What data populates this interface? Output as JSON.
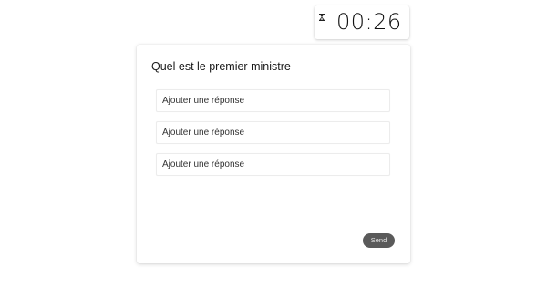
{
  "timer": {
    "icon": "hourglass-icon",
    "value": "00:26"
  },
  "question": {
    "title": "Quel est le premier ministre"
  },
  "answers": [
    {
      "placeholder": "Ajouter une réponse",
      "value": ""
    },
    {
      "placeholder": "Ajouter une réponse",
      "value": ""
    },
    {
      "placeholder": "Ajouter une réponse",
      "value": ""
    }
  ],
  "actions": {
    "send_label": "Send"
  },
  "colors": {
    "send_button_bg": "#5a5a5a",
    "card_bg": "#ffffff"
  }
}
